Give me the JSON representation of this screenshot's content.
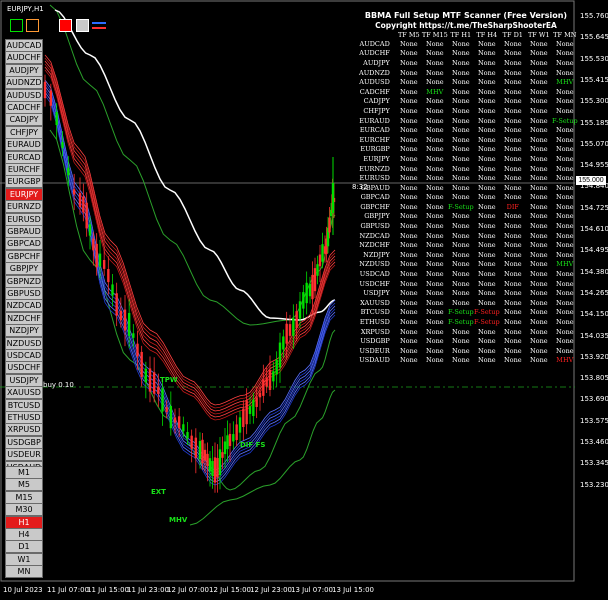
{
  "chart": {
    "title": "EURJPY,H1",
    "timer": "8:32",
    "current_price": "155.000",
    "buy_label": "buy 0.10"
  },
  "color_boxes": [
    {
      "name": "bull-color-box",
      "color": "#00e000"
    },
    {
      "name": "neutral-color-box",
      "color": "#ff9933"
    },
    {
      "name": "bear-color-box",
      "color": "#ff0000"
    },
    {
      "name": "line-color-box",
      "color": "#2a6cff"
    }
  ],
  "symbols": [
    "AUDCAD",
    "AUDCHF",
    "AUDJPY",
    "AUDNZD",
    "AUDUSD",
    "CADCHF",
    "CADJPY",
    "CHFJPY",
    "EURAUD",
    "EURCAD",
    "EURCHF",
    "EURGBP",
    "EURJPY",
    "EURNZD",
    "EURUSD",
    "GBPAUD",
    "GBPCAD",
    "GBPCHF",
    "GBPJPY",
    "GBPNZD",
    "GBPUSD",
    "NZDCAD",
    "NZDCHF",
    "NZDJPY",
    "NZDUSD",
    "USDCAD",
    "USDCHF",
    "USDJPY",
    "XAUUSD",
    "BTCUSD",
    "ETHUSD",
    "XRPUSD",
    "USDGBP",
    "USDEUR",
    "USDAUD"
  ],
  "active_symbol": "EURJPY",
  "timeframes": [
    "M1",
    "M5",
    "M15",
    "M30",
    "H1",
    "H4",
    "D1",
    "W1",
    "MN"
  ],
  "active_timeframe": "H1",
  "scanner": {
    "title": "BBMA Full Setup MTF Scanner (Free Version)",
    "subtitle": "Copyright https://t.me/TheSharpShooterEA",
    "headers": [
      "TF M5",
      "TF M15",
      "TF H1",
      "TF H4",
      "TF D1",
      "TF W1",
      "TF MN"
    ],
    "rows": [
      {
        "sym": "AUDCAD",
        "v": [
          "None",
          "None",
          "None",
          "None",
          "None",
          "None",
          "None"
        ]
      },
      {
        "sym": "AUDCHF",
        "v": [
          "None",
          "None",
          "None",
          "None",
          "None",
          "None",
          "None"
        ]
      },
      {
        "sym": "AUDJPY",
        "v": [
          "None",
          "None",
          "None",
          "None",
          "None",
          "None",
          "None"
        ]
      },
      {
        "sym": "AUDNZD",
        "v": [
          "None",
          "None",
          "None",
          "None",
          "None",
          "None",
          "None"
        ]
      },
      {
        "sym": "AUDUSD",
        "v": [
          "None",
          "None",
          "None",
          "None",
          "None",
          "None",
          "MHV"
        ]
      },
      {
        "sym": "CADCHF",
        "v": [
          "None",
          "MHV",
          "None",
          "None",
          "None",
          "None",
          "None"
        ]
      },
      {
        "sym": "CADJPY",
        "v": [
          "None",
          "None",
          "None",
          "None",
          "None",
          "None",
          "None"
        ]
      },
      {
        "sym": "CHFJPY",
        "v": [
          "None",
          "None",
          "None",
          "None",
          "None",
          "None",
          "None"
        ]
      },
      {
        "sym": "EURAUD",
        "v": [
          "None",
          "None",
          "None",
          "None",
          "None",
          "None",
          "F-Setup"
        ]
      },
      {
        "sym": "EURCAD",
        "v": [
          "None",
          "None",
          "None",
          "None",
          "None",
          "None",
          "None"
        ]
      },
      {
        "sym": "EURCHF",
        "v": [
          "None",
          "None",
          "None",
          "None",
          "None",
          "None",
          "None"
        ]
      },
      {
        "sym": "EURGBP",
        "v": [
          "None",
          "None",
          "None",
          "None",
          "None",
          "None",
          "None"
        ]
      },
      {
        "sym": "EURJPY",
        "v": [
          "None",
          "None",
          "None",
          "None",
          "None",
          "None",
          "None"
        ]
      },
      {
        "sym": "EURNZD",
        "v": [
          "None",
          "None",
          "None",
          "None",
          "None",
          "None",
          "None"
        ]
      },
      {
        "sym": "EURUSD",
        "v": [
          "None",
          "None",
          "None",
          "None",
          "None",
          "None",
          "None"
        ]
      },
      {
        "sym": "GBPAUD",
        "v": [
          "None",
          "None",
          "None",
          "None",
          "None",
          "None",
          "None"
        ]
      },
      {
        "sym": "GBPCAD",
        "v": [
          "None",
          "None",
          "None",
          "None",
          "None",
          "None",
          "None"
        ]
      },
      {
        "sym": "GBPCHF",
        "v": [
          "None",
          "None",
          "F-Setup",
          "None",
          "DIF",
          "None",
          "None"
        ]
      },
      {
        "sym": "GBPJPY",
        "v": [
          "None",
          "None",
          "None",
          "None",
          "None",
          "None",
          "None"
        ]
      },
      {
        "sym": "GBPUSD",
        "v": [
          "None",
          "None",
          "None",
          "None",
          "None",
          "None",
          "None"
        ]
      },
      {
        "sym": "NZDCAD",
        "v": [
          "None",
          "None",
          "None",
          "None",
          "None",
          "None",
          "None"
        ]
      },
      {
        "sym": "NZDCHF",
        "v": [
          "None",
          "None",
          "None",
          "None",
          "None",
          "None",
          "None"
        ]
      },
      {
        "sym": "NZDJPY",
        "v": [
          "None",
          "None",
          "None",
          "None",
          "None",
          "None",
          "None"
        ]
      },
      {
        "sym": "NZDUSD",
        "v": [
          "None",
          "None",
          "None",
          "None",
          "None",
          "None",
          "MHV"
        ]
      },
      {
        "sym": "USDCAD",
        "v": [
          "None",
          "None",
          "None",
          "None",
          "None",
          "None",
          "None"
        ]
      },
      {
        "sym": "USDCHF",
        "v": [
          "None",
          "None",
          "None",
          "None",
          "None",
          "None",
          "None"
        ]
      },
      {
        "sym": "USDJPY",
        "v": [
          "None",
          "None",
          "None",
          "None",
          "None",
          "None",
          "None"
        ]
      },
      {
        "sym": "XAUUSD",
        "v": [
          "None",
          "None",
          "None",
          "None",
          "None",
          "None",
          "None"
        ]
      },
      {
        "sym": "BTCUSD",
        "v": [
          "None",
          "None",
          "F-Setup",
          "F-Setup",
          "None",
          "None",
          "None"
        ]
      },
      {
        "sym": "ETHUSD",
        "v": [
          "None",
          "None",
          "F-Setup",
          "F-Setup",
          "None",
          "None",
          "None"
        ]
      },
      {
        "sym": "XRPUSD",
        "v": [
          "None",
          "None",
          "None",
          "None",
          "None",
          "None",
          "None"
        ]
      },
      {
        "sym": "USDGBP",
        "v": [
          "None",
          "None",
          "None",
          "None",
          "None",
          "None",
          "None"
        ]
      },
      {
        "sym": "USDEUR",
        "v": [
          "None",
          "None",
          "None",
          "None",
          "None",
          "None",
          "None"
        ]
      },
      {
        "sym": "USDAUD",
        "v": [
          "None",
          "None",
          "None",
          "None",
          "None",
          "None",
          "MHV"
        ]
      }
    ],
    "value_colors": {
      "None": "#ffffff",
      "MHV": "#19e219",
      "F-Setup": "#19e219",
      "DIF": "#ff2020"
    },
    "value_colors_by_cell": {
      "BTCUSD-3": "#ff2020",
      "ETHUSD-3": "#ff2020",
      "USDAUD-6": "#ff2020"
    }
  },
  "price_axis": [
    "155.760",
    "155.645",
    "155.530",
    "155.415",
    "155.300",
    "155.185",
    "155.070",
    "154.955",
    "154.840",
    "154.725",
    "154.610",
    "154.495",
    "154.380",
    "154.265",
    "154.150",
    "154.035",
    "153.920",
    "153.805",
    "153.690",
    "153.575",
    "153.460",
    "153.345",
    "153.230"
  ],
  "time_axis": [
    "10 Jul 2023",
    "11 Jul 07:00",
    "11 Jul 15:00",
    "11 Jul 23:00",
    "12 Jul 07:00",
    "12 Jul 15:00",
    "12 Jul 23:00",
    "13 Jul 07:00",
    "13 Jul 15:00"
  ],
  "chart_labels": {
    "tpw": "TPW",
    "ext": "EXT",
    "mhv": "MHV",
    "dif": "DIF FS"
  },
  "colors": {
    "bull": "#00e000",
    "bear": "#ff3030",
    "accent": "#e31b1b"
  }
}
